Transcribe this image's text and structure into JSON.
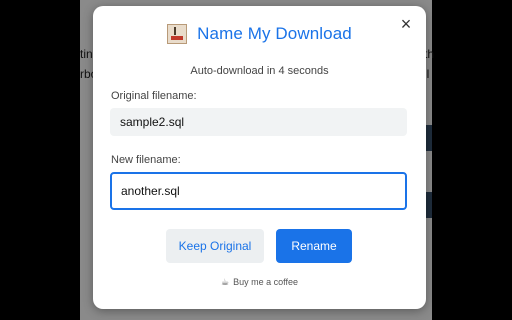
{
  "background": {
    "left_text": [
      "tind",
      "rbo"
    ],
    "right_text": [
      "th",
      "il"
    ]
  },
  "modal": {
    "close_glyph": "×",
    "icon": "app-logo-icon",
    "title": "Name My Download",
    "countdown": "Auto-download in 4 seconds",
    "original_label": "Original filename:",
    "original_value": "sample2.sql",
    "new_label": "New filename:",
    "new_value": "another.sql",
    "keep_button": "Keep Original",
    "rename_button": "Rename",
    "coffee_icon": "coffee-cup-icon",
    "coffee_glyph": "☕",
    "coffee_text": "Buy me a coffee"
  },
  "colors": {
    "accent": "#1a73e8",
    "overlay": "#000000",
    "dimmed_page": "#8a8a8a"
  }
}
